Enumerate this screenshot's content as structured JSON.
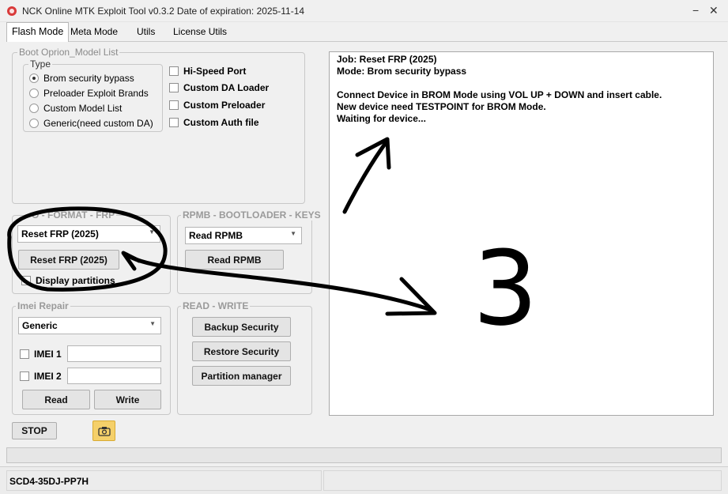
{
  "window": {
    "title": "NCK Online MTK Exploit Tool v0.3.2  Date of expiration: 2025-11-14",
    "icon": "nck-app-icon",
    "minimize": "−",
    "close": "✕"
  },
  "tabs": [
    {
      "label": "Flash Mode",
      "active": true
    },
    {
      "label": "Meta Mode",
      "active": false
    },
    {
      "label": "Utils",
      "active": false
    },
    {
      "label": "License Utils",
      "active": false
    }
  ],
  "boot_option": {
    "label": "Boot Oprion_Model List",
    "type_label": "Type",
    "radios": [
      {
        "label": "Brom security bypass",
        "checked": true
      },
      {
        "label": "Preloader Exploit Brands",
        "checked": false
      },
      {
        "label": "Custom Model List",
        "checked": false
      },
      {
        "label": "Generic(need custom DA)",
        "checked": false
      }
    ],
    "checks": [
      {
        "label": "Hi-Speed Port",
        "checked": false
      },
      {
        "label": "Custom DA Loader",
        "checked": false
      },
      {
        "label": "Custom Preloader",
        "checked": false
      },
      {
        "label": "Custom Auth file",
        "checked": false
      }
    ]
  },
  "format_frp": {
    "label": "O - FORMAT - FRP",
    "select_value": "Reset FRP (2025)",
    "button": "Reset FRP (2025)",
    "display_partitions": "Display partitions"
  },
  "rpmb": {
    "label": "RPMB - BOOTLOADER - KEYS",
    "select_value": "Read RPMB",
    "button": "Read RPMB"
  },
  "imei": {
    "label": "Imei Repair",
    "select_value": "Generic",
    "imei1_label": "IMEI 1",
    "imei1_value": "",
    "imei2_label": "IMEI 2",
    "imei2_value": "",
    "read_button": "Read",
    "write_button": "Write"
  },
  "read_write": {
    "label": "READ - WRITE",
    "buttons": [
      "Backup Security",
      "Restore Security",
      "Partition manager"
    ]
  },
  "bottom": {
    "stop_button": "STOP",
    "camera_icon": "camera-icon"
  },
  "log": {
    "lines": [
      "Job: Reset FRP (2025)",
      "Mode: Brom security bypass",
      "",
      "Connect Device in BROM Mode using VOL UP + DOWN and insert cable.",
      "New device need TESTPOINT for BROM Mode.",
      "Waiting for device..."
    ]
  },
  "progress": {
    "value": 0
  },
  "status": {
    "left": "SCD4-35DJ-PP7H",
    "right": ""
  },
  "annotation": {
    "stroke_color": "#000000",
    "number": "3"
  }
}
